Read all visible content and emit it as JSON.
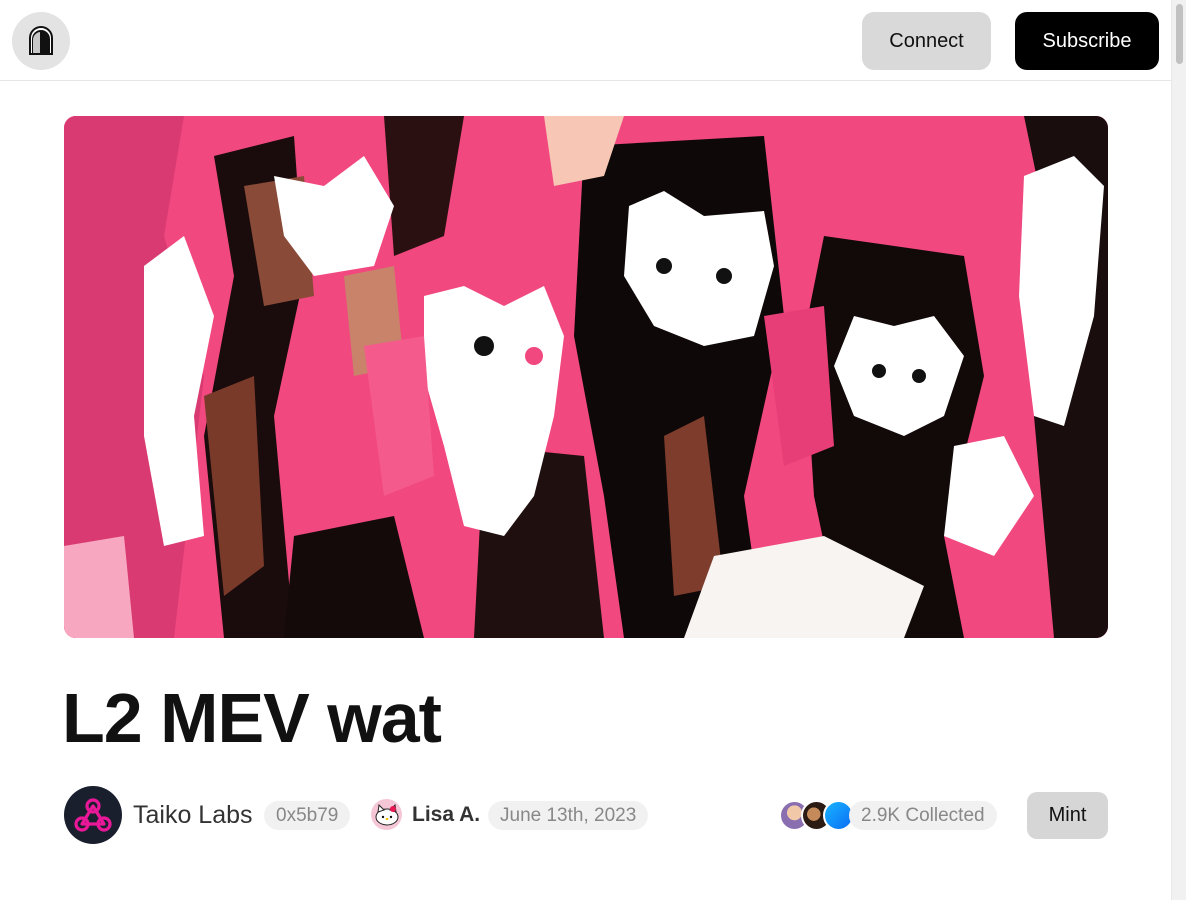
{
  "header": {
    "home_icon": "arch-logo-icon",
    "connect_label": "Connect",
    "subscribe_label": "Subscribe"
  },
  "post": {
    "cover_image": "pink-black-painted-cats-artwork",
    "title": "L2 MEV wat",
    "publication": {
      "name": "Taiko Labs",
      "address": "0x5b79",
      "avatar_icon": "taiko-logo-icon"
    },
    "author": {
      "name": "Lisa A.",
      "avatar_icon": "hello-kitty-avatar"
    },
    "date": "June 13th, 2023",
    "collected": "2.9K Collected",
    "mint_label": "Mint"
  },
  "colors": {
    "accent_pink": "#f0487f",
    "taiko_pink": "#e81899",
    "black": "#000000"
  }
}
